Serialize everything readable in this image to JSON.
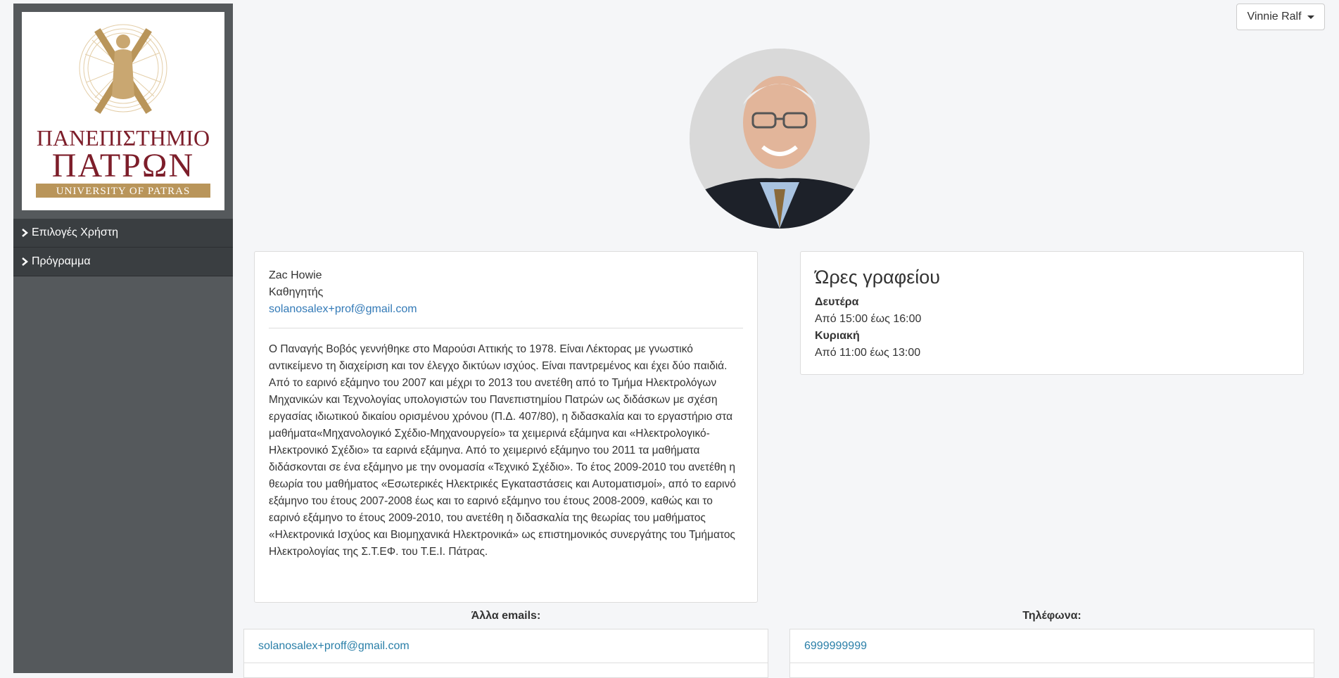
{
  "sidebar": {
    "logo": {
      "line1": "ΠΑΝΕΠΙΣΤΗΜΙΟ",
      "line2": "ΠΑΤΡΩΝ",
      "line3": "UNIVERSITY OF PATRAS"
    },
    "items": [
      {
        "label": "Επιλογές Χρήστη",
        "icon": "chevron-right-icon"
      },
      {
        "label": "Πρόγραμμα",
        "icon": "chevron-right-icon"
      }
    ]
  },
  "header": {
    "user_label": "Vinnie Ralf"
  },
  "profile": {
    "name": "Zac Howie",
    "title": "Καθηγητής",
    "email": "solanosalex+prof@gmail.com",
    "bio": "Ο Παναγής Βοβός γεννήθηκε στο Μαρούσι Αττικής το 1978. Είναι Λέκτορας με γνωστικό αντικείμενο τη διαχείριση και τον έλεγχο δικτύων ισχύος. Είναι παντρεμένος και έχει δύο παιδιά. Από το εαρινό εξάμηνο του 2007 και μέχρι το 2013 του ανετέθη από το Τμήμα Ηλεκτρολόγων Μηχανικών και Τεχνολογίας υπολογιστών του Πανεπιστημίου Πατρών ως διδάσκων με σχέση εργασίας ιδιωτικού δικαίου ορισμένου χρόνου (Π.Δ. 407/80), η διδασκαλία και το εργαστήριο στα μαθήματα«Μηχανολογικό Σχέδιο-Μηχανουργείο» τα χειμερινά εξάμηνα και «Ηλεκτρολογικό-Ηλεκτρονικό Σχέδιο» τα εαρινά εξάμηνα. Από το χειμερινό εξάμηνο του 2011 τα μαθήματα διδάσκονται σε ένα εξάμηνο με την ονομασία «Τεχνικό Σχέδιο». Το έτος 2009-2010 του ανετέθη η θεωρία του μαθήματος «Εσωτερικές Ηλεκτρικές Εγκαταστάσεις και Αυτοματισμοί», από το εαρινό εξάμηνο του έτους 2007-2008 έως και το εαρινό εξάμηνο του έτους 2008-2009, καθώς και το εαρινό εξάμηνο το έτους 2009-2010, του ανετέθη η διδασκαλία της θεωρίας του μαθήματος «Ηλεκτρονικά Ισχύος και Βιομηχανικά Ηλεκτρονικά» ως επιστημονικός συνεργάτης του Τμήματος Ηλεκτρολογίας της Σ.Τ.ΕΦ. του Τ.Ε.Ι. Πάτρας."
  },
  "office_hours": {
    "title": "Ώρες γραφείου",
    "days": [
      {
        "day": "Δευτέρα",
        "hours": "Από 15:00 έως 16:00"
      },
      {
        "day": "Κυριακή",
        "hours": "Από 11:00 έως 13:00"
      }
    ]
  },
  "other_emails": {
    "title": "Άλλα emails:",
    "items": [
      "solanosalex+proff@gmail.com"
    ]
  },
  "phones": {
    "title": "Τηλέφωνα:",
    "items": [
      "6999999999"
    ]
  },
  "colors": {
    "sidebar_bg": "#55595c",
    "menu_bg": "#3a3e41",
    "link": "#337ab7",
    "logo_red": "#7d1e2a",
    "logo_gold": "#b9955a"
  }
}
